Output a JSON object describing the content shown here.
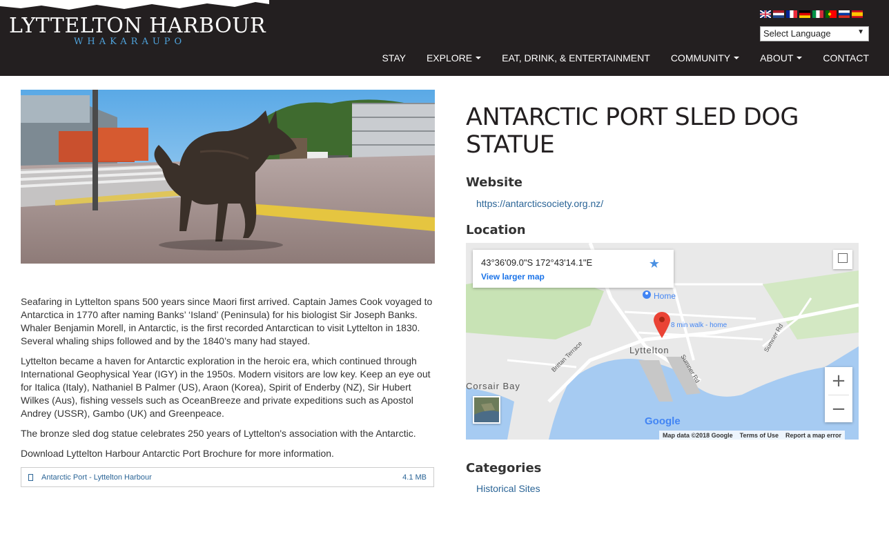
{
  "header": {
    "logo_main": "LYTTELTON HARBOUR",
    "logo_sub": "WHAKARAUPO",
    "languages": [
      "en",
      "nl",
      "fr",
      "de",
      "it",
      "pt",
      "ru",
      "es"
    ],
    "language_select": "Select Language",
    "nav": [
      {
        "label": "STAY",
        "dropdown": false
      },
      {
        "label": "EXPLORE",
        "dropdown": true
      },
      {
        "label": "EAT, DRINK, & ENTERTAINMENT",
        "dropdown": false
      },
      {
        "label": "COMMUNITY",
        "dropdown": true
      },
      {
        "label": "ABOUT",
        "dropdown": true
      },
      {
        "label": "CONTACT",
        "dropdown": false
      }
    ]
  },
  "content": {
    "paragraphs": [
      "Seafaring in Lyttelton spans 500 years since Maori first arrived. Captain James Cook voyaged to Antarctica in 1770 after naming Banks’ ‘Island’ (Peninsula) for his biologist Sir Joseph Banks. Whaler Benjamin Morell, in Antarctic, is the first recorded Antarctican to visit Lyttelton in 1830. Several whaling ships followed and by the 1840’s many had stayed.",
      "Lyttelton became a haven for Antarctic exploration in the heroic era, which continued through International Geophysical Year (IGY) in the 1950s. Modern visitors are low key. Keep an eye out for Italica (Italy), Nathaniel B Palmer (US), Araon (Korea), Spirit of Enderby (NZ), Sir Hubert Wilkes (Aus), fishing vessels such as OceanBreeze and private expeditions such as Apostol Andrey (USSR), Gambo (UK) and Greenpeace.",
      "The bronze sled dog statue celebrates 250 years of Lyttelton's association with the Antarctic.",
      "Download Lyttelton Harbour Antarctic Port Brochure for more information."
    ],
    "download": {
      "label": "Antarctic Port - Lyttelton Harbour",
      "size": "4.1 MB"
    }
  },
  "sidebar": {
    "title": "ANTARCTIC PORT SLED DOG STATUE",
    "website_heading": "Website",
    "website_url": "https://antarcticsociety.org.nz/",
    "location_heading": "Location",
    "categories_heading": "Categories",
    "category": "Historical Sites"
  },
  "map": {
    "coords": "43°36'09.0\"S 172°43'14.1\"E",
    "view_larger": "View larger map",
    "home_label": "Home",
    "walk_label": "8 min walk - home",
    "town_label": "Lyttelton",
    "bay_label": "Corsair Bay",
    "road1": "Brittan Terrace",
    "road2": "Sumner Rd",
    "road3": "Sumner Rd",
    "zoom_in": "+",
    "zoom_out": "−",
    "google": "Google",
    "footer": [
      "Map data ©2018 Google",
      "Terms of Use",
      "Report a map error"
    ]
  }
}
